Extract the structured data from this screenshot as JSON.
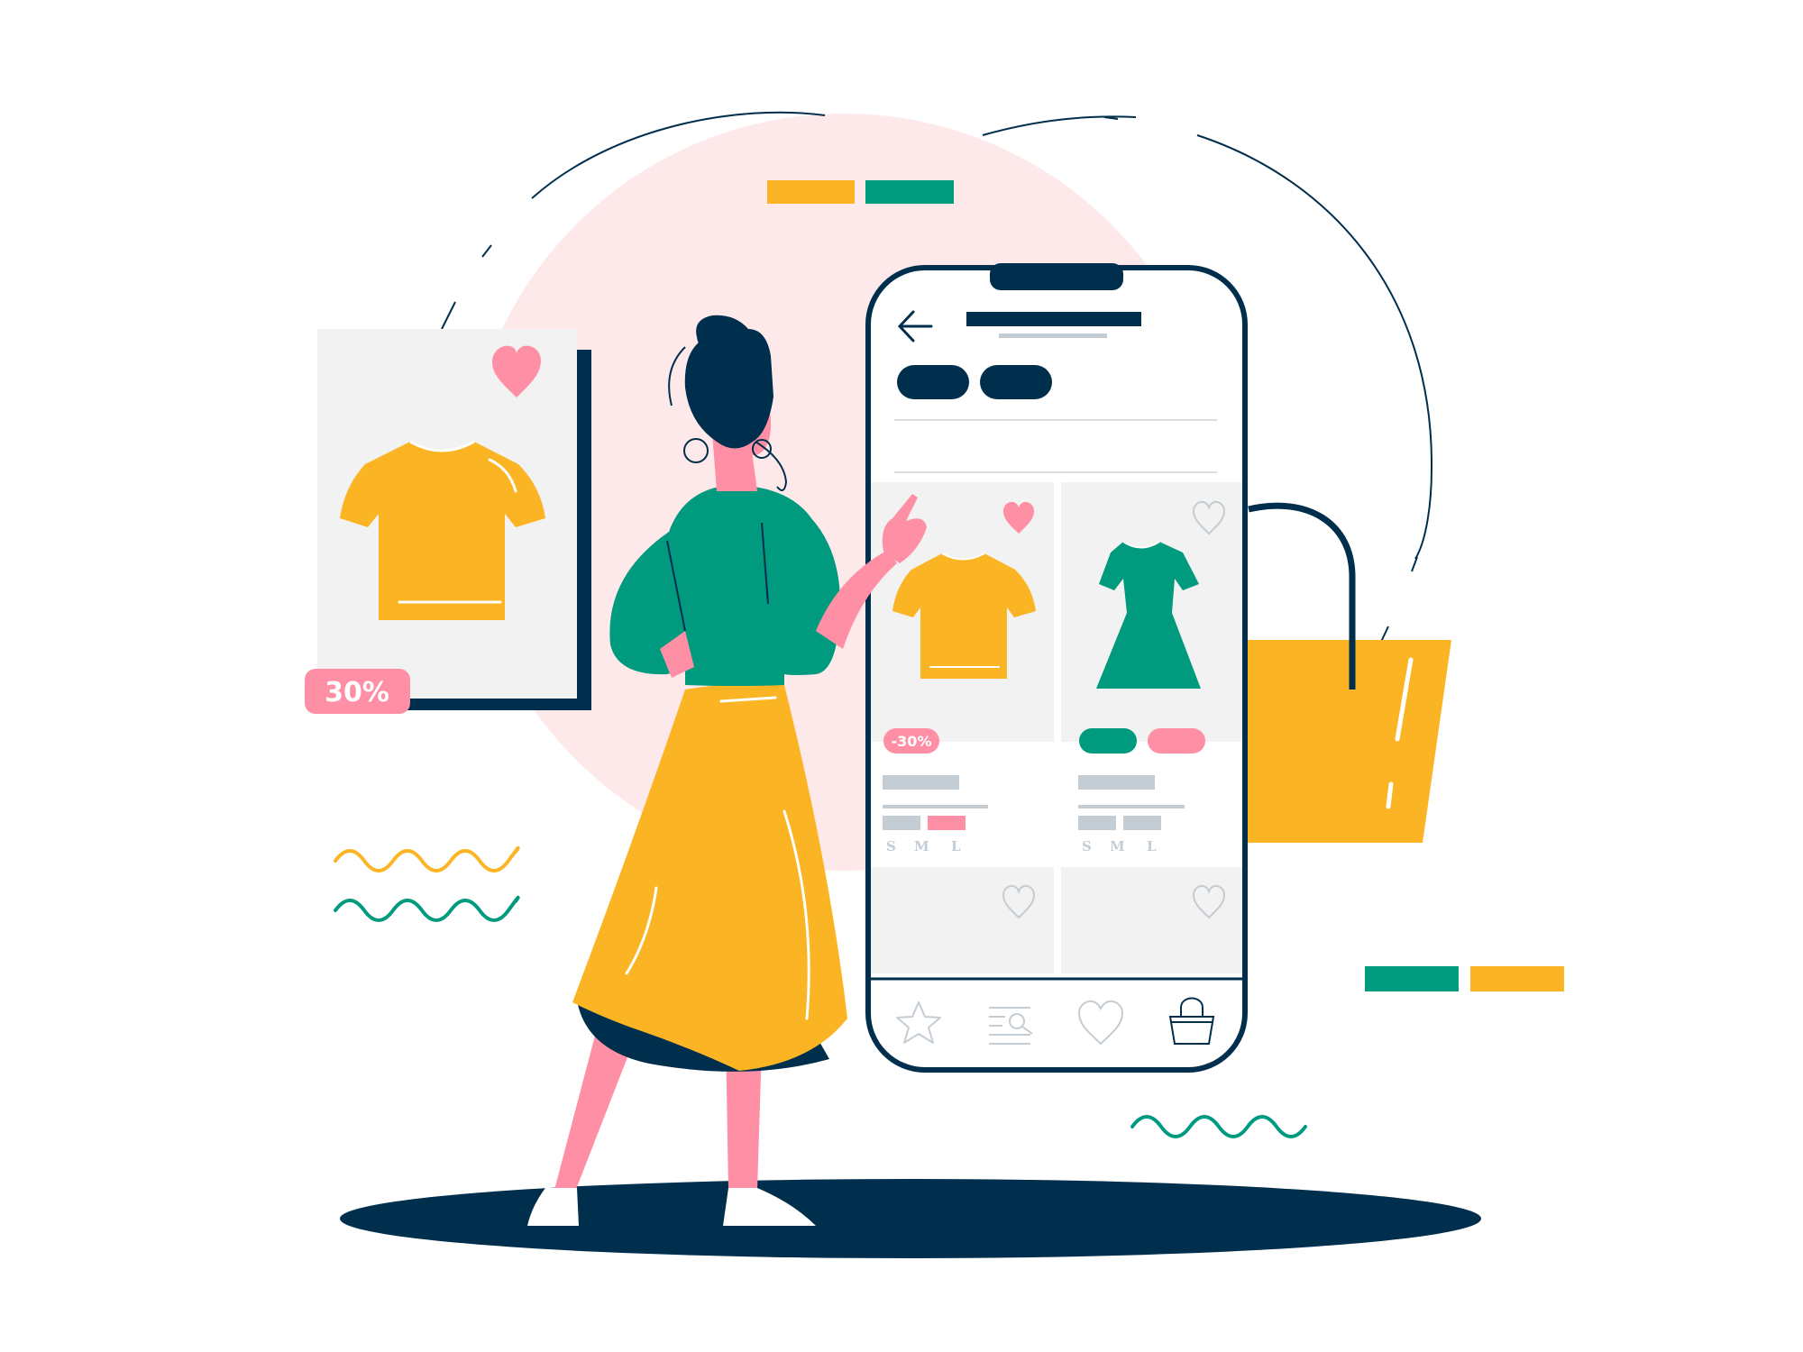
{
  "colors": {
    "navy": "#002e4d",
    "yellow": "#fbb423",
    "green": "#009a7e",
    "pink": "#ff8fa5",
    "blush": "#fde9e9",
    "panel": "#f2f2f2",
    "placeholder": "#c4ccd4",
    "white": "#ffffff"
  },
  "promo_card": {
    "discount": "30%",
    "product_icon": "tshirt-icon",
    "favorite_icon": "heart-filled-icon"
  },
  "phone": {
    "header": {
      "back_icon": "arrow-left-icon"
    },
    "products": [
      {
        "icon": "tshirt-icon",
        "discount": "-30%",
        "favorite": true,
        "sizes": [
          "S",
          "M",
          "L"
        ]
      },
      {
        "icon": "dress-icon",
        "favorite": false,
        "sizes": [
          "S",
          "M",
          "L"
        ]
      },
      {
        "icon": "",
        "favorite": false
      },
      {
        "icon": "",
        "favorite": false
      }
    ],
    "tab_bar": [
      {
        "name": "tab-favorites-star",
        "icon": "star-icon"
      },
      {
        "name": "tab-search-filter",
        "icon": "search-list-icon"
      },
      {
        "name": "tab-wishlist",
        "icon": "heart-outline-icon"
      },
      {
        "name": "tab-bag",
        "icon": "shopping-bag-icon"
      }
    ]
  },
  "decorations": {
    "shopping_bag_icon": "shopping-bag-icon",
    "woman": "woman-figure"
  }
}
